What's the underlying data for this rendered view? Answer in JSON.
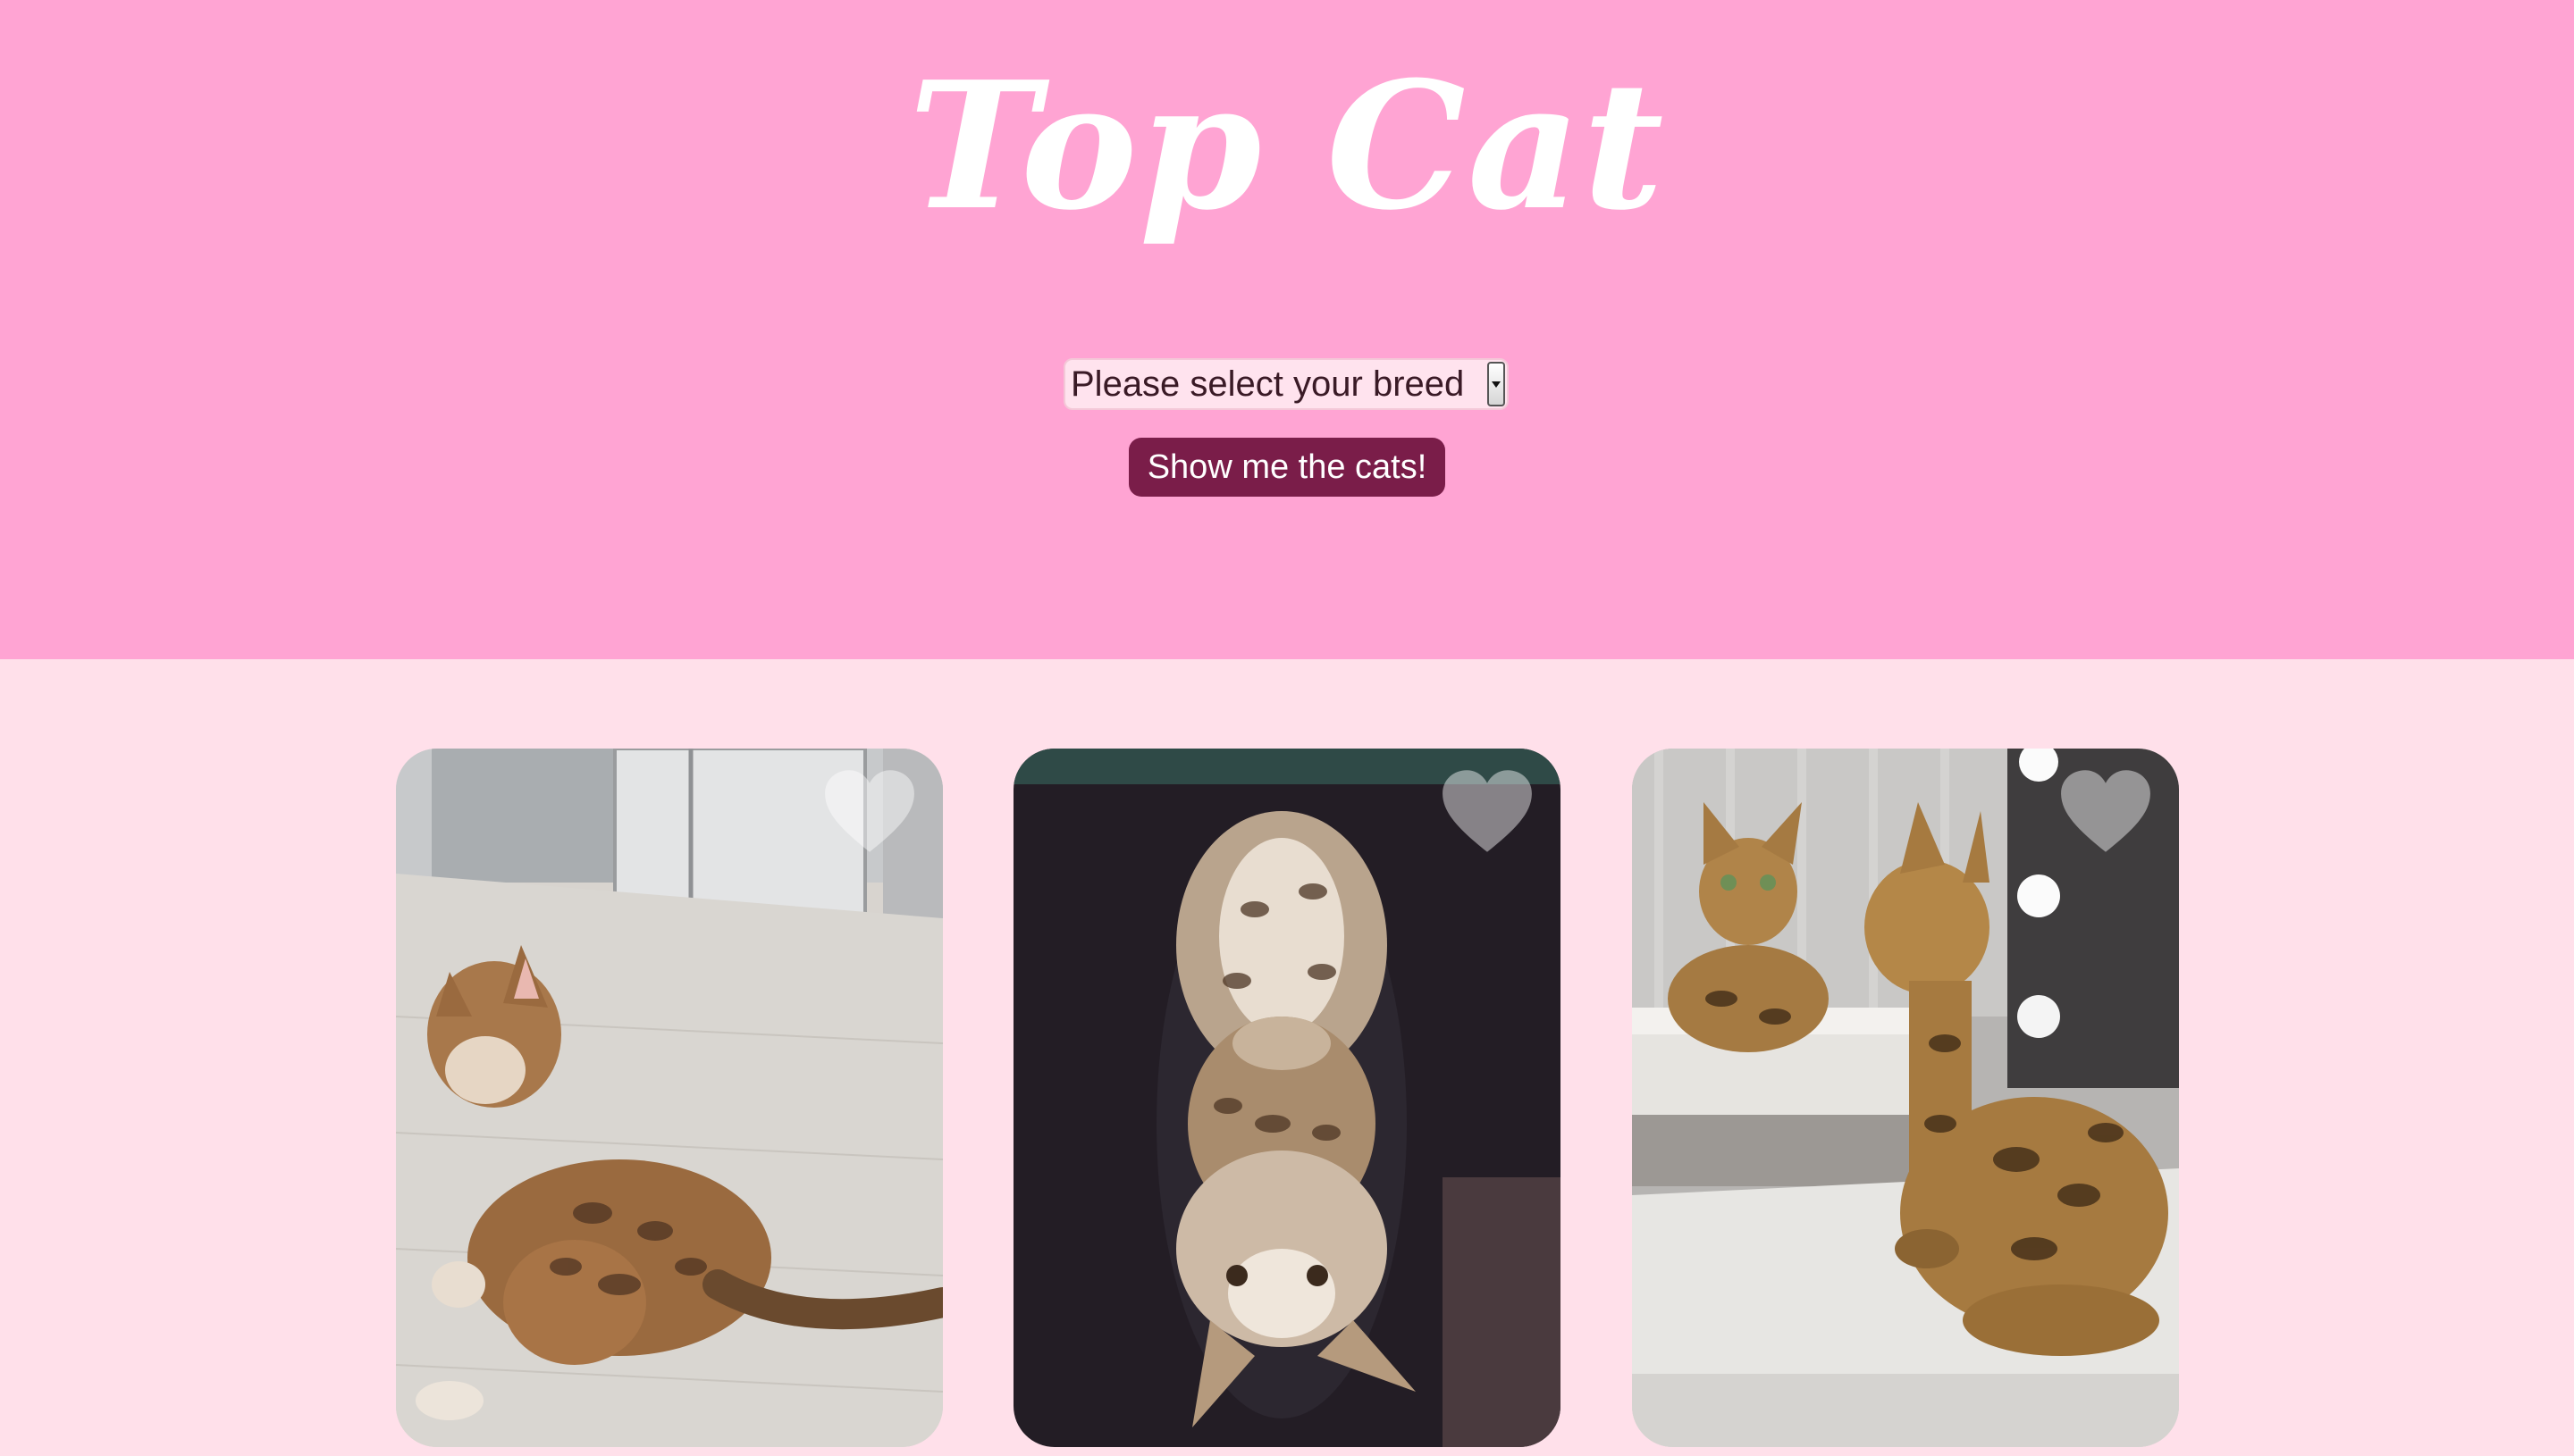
{
  "header": {
    "title": "Top Cat",
    "background": "#ffa4d3"
  },
  "breed_select": {
    "selected": "Please select your breed"
  },
  "show_button": {
    "label": "Show me the cats!",
    "color": "#7a1d49"
  },
  "gallery": {
    "background": "#ffe0ea",
    "cards": [
      {
        "photo": "bengal cat scratching its neck on a wooden floor",
        "favorite_icon": "heart-icon",
        "favorited": false
      },
      {
        "photo": "bengal kitten lying upside down on a lap",
        "favorite_icon": "heart-icon",
        "favorited": false
      },
      {
        "photo": "bengal cat looking at itself in a mirror",
        "favorite_icon": "heart-icon",
        "favorited": false
      }
    ]
  }
}
